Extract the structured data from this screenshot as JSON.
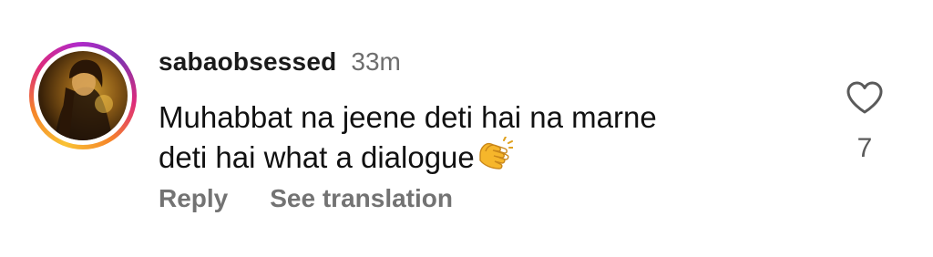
{
  "comment": {
    "username": "sabaobsessed",
    "timestamp": "33m",
    "text_lines": [
      "Muhabbat na jeene deti hai na marne",
      "deti hai what a dialogue"
    ],
    "emoji": "clapping-hands",
    "likes": "7",
    "actions": {
      "reply_label": "Reply",
      "translate_label": "See translation"
    }
  },
  "colors": {
    "username": "#1a1a1a",
    "timestamp": "#6e6e6e",
    "action": "#737373",
    "story_ring": [
      "#f9c234",
      "#f58529",
      "#dd2a7b",
      "#8134af"
    ]
  }
}
